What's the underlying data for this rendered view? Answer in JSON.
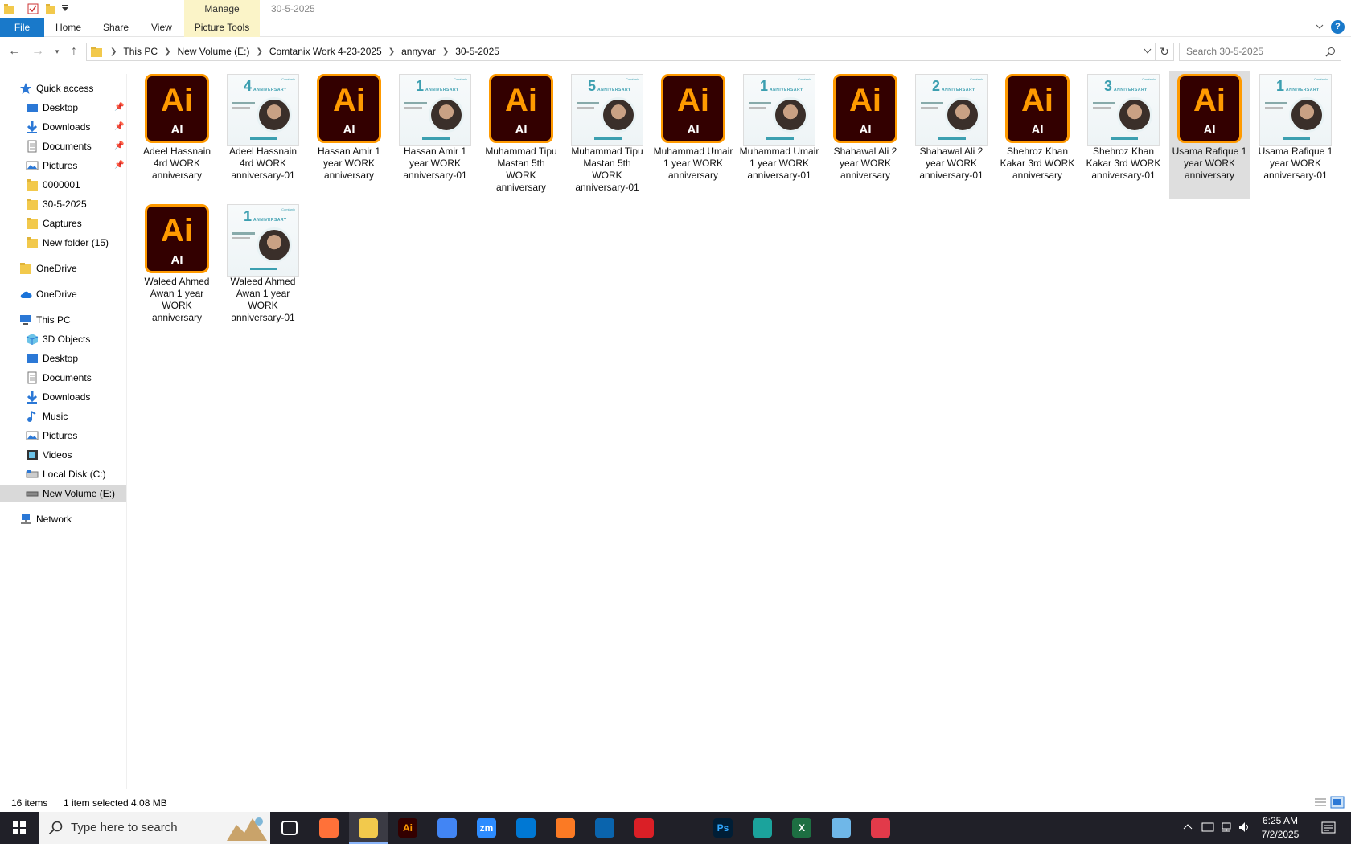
{
  "window": {
    "title": "30-5-2025"
  },
  "ribbon": {
    "manage_label": "Manage",
    "tabs": [
      "File",
      "Home",
      "Share",
      "View",
      "Picture Tools"
    ]
  },
  "address": {
    "crumbs": [
      "This PC",
      "New Volume (E:)",
      "Comtanix Work 4-23-2025",
      "annyvar",
      "30-5-2025"
    ]
  },
  "search": {
    "placeholder": "Search 30-5-2025"
  },
  "sidebar": {
    "quick_access": "Quick access",
    "quick_items": [
      "Desktop",
      "Downloads",
      "Documents",
      "Pictures",
      "0000001",
      "30-5-2025",
      "Captures",
      "New folder (15)"
    ],
    "onedrive1": "OneDrive",
    "onedrive2": "OneDrive",
    "this_pc": "This PC",
    "pc_items": [
      "3D Objects",
      "Desktop",
      "Documents",
      "Downloads",
      "Music",
      "Pictures",
      "Videos",
      "Local Disk (C:)",
      "New Volume (E:)"
    ],
    "network": "Network"
  },
  "files": [
    {
      "name": "Adeel Hassnain 4rd  WORK anniversary",
      "type": "ai"
    },
    {
      "name": "Adeel Hassnain 4rd  WORK anniversary-01",
      "type": "img",
      "num": "4"
    },
    {
      "name": "Hassan Amir  1 year WORK anniversary",
      "type": "ai"
    },
    {
      "name": "Hassan Amir  1 year WORK anniversary-01",
      "type": "img",
      "num": "1"
    },
    {
      "name": "Muhammad Tipu Mastan   5th WORK anniversary",
      "type": "ai"
    },
    {
      "name": "Muhammad Tipu Mastan   5th WORK anniversary-01",
      "type": "img",
      "num": "5"
    },
    {
      "name": "Muhammad Umair 1 year WORK anniversary",
      "type": "ai"
    },
    {
      "name": "Muhammad Umair 1 year WORK anniversary-01",
      "type": "img",
      "num": "1"
    },
    {
      "name": "Shahawal Ali  2 year WORK anniversary",
      "type": "ai"
    },
    {
      "name": "Shahawal Ali  2 year WORK anniversary-01",
      "type": "img",
      "num": "2"
    },
    {
      "name": "Shehroz Khan Kakar    3rd WORK anniversary",
      "type": "ai"
    },
    {
      "name": "Shehroz Khan Kakar    3rd WORK anniversary-01",
      "type": "img",
      "num": "3"
    },
    {
      "name": "Usama Rafique 1 year WORK anniversary",
      "type": "ai",
      "selected": true
    },
    {
      "name": "Usama Rafique 1 year WORK anniversary-01",
      "type": "img",
      "num": "1"
    },
    {
      "name": "Waleed Ahmed Awan   1 year WORK anniversary",
      "type": "ai"
    },
    {
      "name": "Waleed Ahmed Awan   1 year WORK anniversary-01",
      "type": "img",
      "num": "1"
    }
  ],
  "ai_icon": {
    "big": "Ai",
    "small": "AI"
  },
  "poster_text": {
    "ann": "ANNIVERSARY",
    "brand": "Comtanix"
  },
  "status": {
    "count": "16 items",
    "selection": "1 item selected  4.08 MB"
  },
  "taskbar": {
    "search_placeholder": "Type here to search",
    "time": "6:25 AM",
    "date": "7/2/2025",
    "apps": [
      {
        "name": "task-view",
        "label": "",
        "color": "#202028"
      },
      {
        "name": "firefox",
        "label": "",
        "color": "#ff7139"
      },
      {
        "name": "file-explorer",
        "label": "",
        "color": "#f2c94c",
        "active": true
      },
      {
        "name": "illustrator",
        "label": "Ai",
        "color": "#330000"
      },
      {
        "name": "chrome",
        "label": "",
        "color": "#4285f4"
      },
      {
        "name": "zoom",
        "label": "zm",
        "color": "#2d8cff"
      },
      {
        "name": "vscode",
        "label": "",
        "color": "#0078d4"
      },
      {
        "name": "xampp",
        "label": "",
        "color": "#fb7a24"
      },
      {
        "name": "outlook",
        "label": "",
        "color": "#0a64ad"
      },
      {
        "name": "creative-cloud",
        "label": "",
        "color": "#da1f26"
      },
      {
        "name": "pen-tool",
        "label": "",
        "color": "#202028"
      },
      {
        "name": "photoshop",
        "label": "Ps",
        "color": "#001e36"
      },
      {
        "name": "app-teal",
        "label": "",
        "color": "#1ba39c"
      },
      {
        "name": "excel",
        "label": "X",
        "color": "#1d6f42"
      },
      {
        "name": "notepad",
        "label": "",
        "color": "#6fb7e8"
      },
      {
        "name": "snip-tool",
        "label": "",
        "color": "#e23a4a"
      }
    ]
  },
  "colors": {
    "accent": "#1979ca",
    "picture_tools": "#fbf4c8",
    "ai_orange": "#ff9a00",
    "ai_bg": "#330000"
  }
}
